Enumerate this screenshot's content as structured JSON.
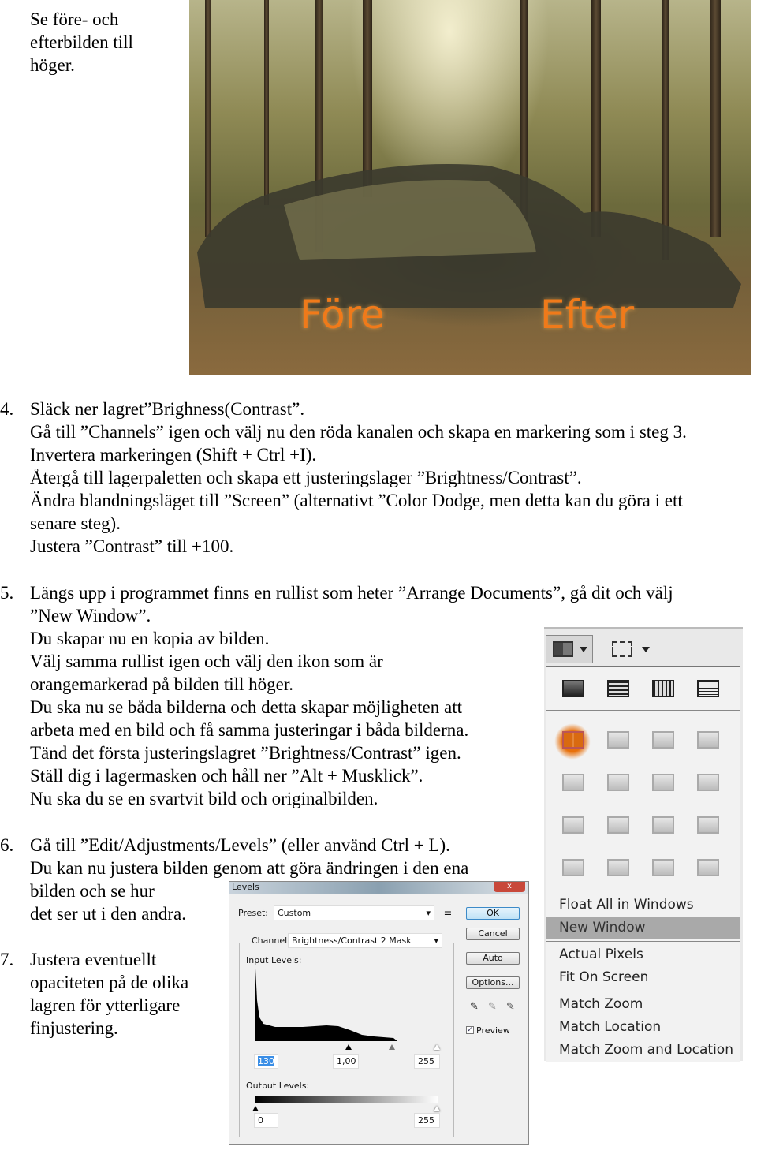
{
  "intro": {
    "lines": [
      "Se före- och",
      "efterbilden till",
      "höger."
    ]
  },
  "photo": {
    "label_before": "Före",
    "label_after": "Efter",
    "label_color": "#f07a1a"
  },
  "step4": {
    "number": "4.",
    "lines": [
      "Släck ner lagret”Brighness(Contrast”.",
      "Gå till ”Channels” igen och välj nu den röda kanalen och skapa en markering som i steg 3.",
      "Invertera markeringen (Shift + Ctrl +I).",
      "Återgå till lagerpaletten och skapa ett justeringslager ”Brightness/Contrast”.",
      "Ändra blandningsläget till ”Screen” (alternativt ”Color Dodge, men detta kan du göra i ett",
      "senare steg).",
      "Justera ”Contrast” till +100."
    ]
  },
  "step5": {
    "number": "5.",
    "lines": [
      "Längs upp i programmet finns en rullist som heter ”Arrange Documents”, gå dit och välj",
      "”New Window”.",
      "Du skapar nu en kopia av bilden.",
      "Välj samma rullist igen och välj den ikon som är",
      "orangemarkerad på bilden till höger.",
      "Du ska nu se båda bilderna och detta skapar möjligheten att",
      "arbeta med en bild och få samma justeringar i båda bilderna.",
      "Tänd det första justeringslagret ”Brightness/Contrast” igen.",
      "Ställ dig i lagermasken och håll ner ”Alt + Musklick”.",
      "Nu ska du se en svartvit bild och originalbilden."
    ]
  },
  "step6": {
    "number": "6.",
    "lines": [
      "Gå till ”Edit/Adjustments/Levels” (eller använd Ctrl + L).",
      "Du kan nu justera bilden genom att göra ändringen i den ena",
      "bilden och se hur",
      "det ser ut i den andra."
    ]
  },
  "step7": {
    "number": "7.",
    "lines": [
      "Justera eventuellt",
      "opaciteten på de olika",
      "lagren för ytterligare",
      "finjustering."
    ]
  },
  "arrange_menu": {
    "highlight_color": "#e8700a",
    "items": [
      "Float All in Windows",
      "New Window",
      "Actual Pixels",
      "Fit On Screen",
      "Match Zoom",
      "Match Location",
      "Match Zoom and Location"
    ],
    "selected": "New Window"
  },
  "levels": {
    "title": "Levels",
    "close": "x",
    "preset_label": "Preset:",
    "preset_value": "Custom",
    "channel_label": "Channel:",
    "channel_value": "Brightness/Contrast 2 Mask",
    "input_label": "Input Levels:",
    "input_values": [
      "130",
      "1,00",
      "255"
    ],
    "output_label": "Output Levels:",
    "output_values": [
      "0",
      "255"
    ],
    "buttons": {
      "ok": "OK",
      "cancel": "Cancel",
      "auto": "Auto",
      "options": "Options..."
    },
    "preview_label": "Preview",
    "preview_checked": true
  }
}
